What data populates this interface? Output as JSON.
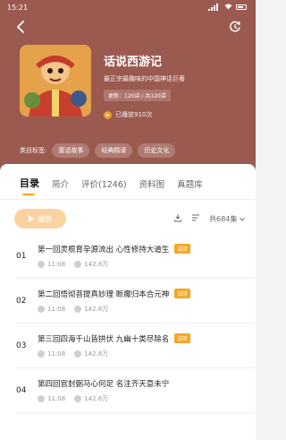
{
  "status": {
    "time": "15:21"
  },
  "book": {
    "title": "话说西游记",
    "subtitle": "最正宗最趣味的中国神话巨著",
    "update": "更新：120讲 / 共120讲",
    "plays": "已播放910次"
  },
  "tags": {
    "label": "类目标签:",
    "items": [
      "童话故事",
      "经典精读",
      "历史文化"
    ]
  },
  "tabs": [
    "目录",
    "简介",
    "评价(1246)",
    "资料图",
    "真题库"
  ],
  "controls": {
    "play_label": "播放",
    "episodes_count": "共684集"
  },
  "episodes": [
    {
      "num": "01",
      "title": "第一回灵根育孕源流出 心性修持大道生",
      "badge": "试听",
      "duration": "11:08",
      "plays": "142.8万"
    },
    {
      "num": "02",
      "title": "第二回悟彻菩提真妙理 断魔归本合元神",
      "badge": "试听",
      "duration": "11:08",
      "plays": "142.8万"
    },
    {
      "num": "03",
      "title": "第三回四海千山皆拱伏 九幽十类尽除名",
      "badge": "试听",
      "duration": "11:08",
      "plays": "142.8万"
    },
    {
      "num": "04",
      "title": "第四回官封弼马心何足 名注齐天意未宁",
      "badge": "",
      "duration": "11:08",
      "plays": "142.8万"
    }
  ],
  "colors": {
    "header": "#9b5a4f",
    "accent": "#f6a623"
  }
}
